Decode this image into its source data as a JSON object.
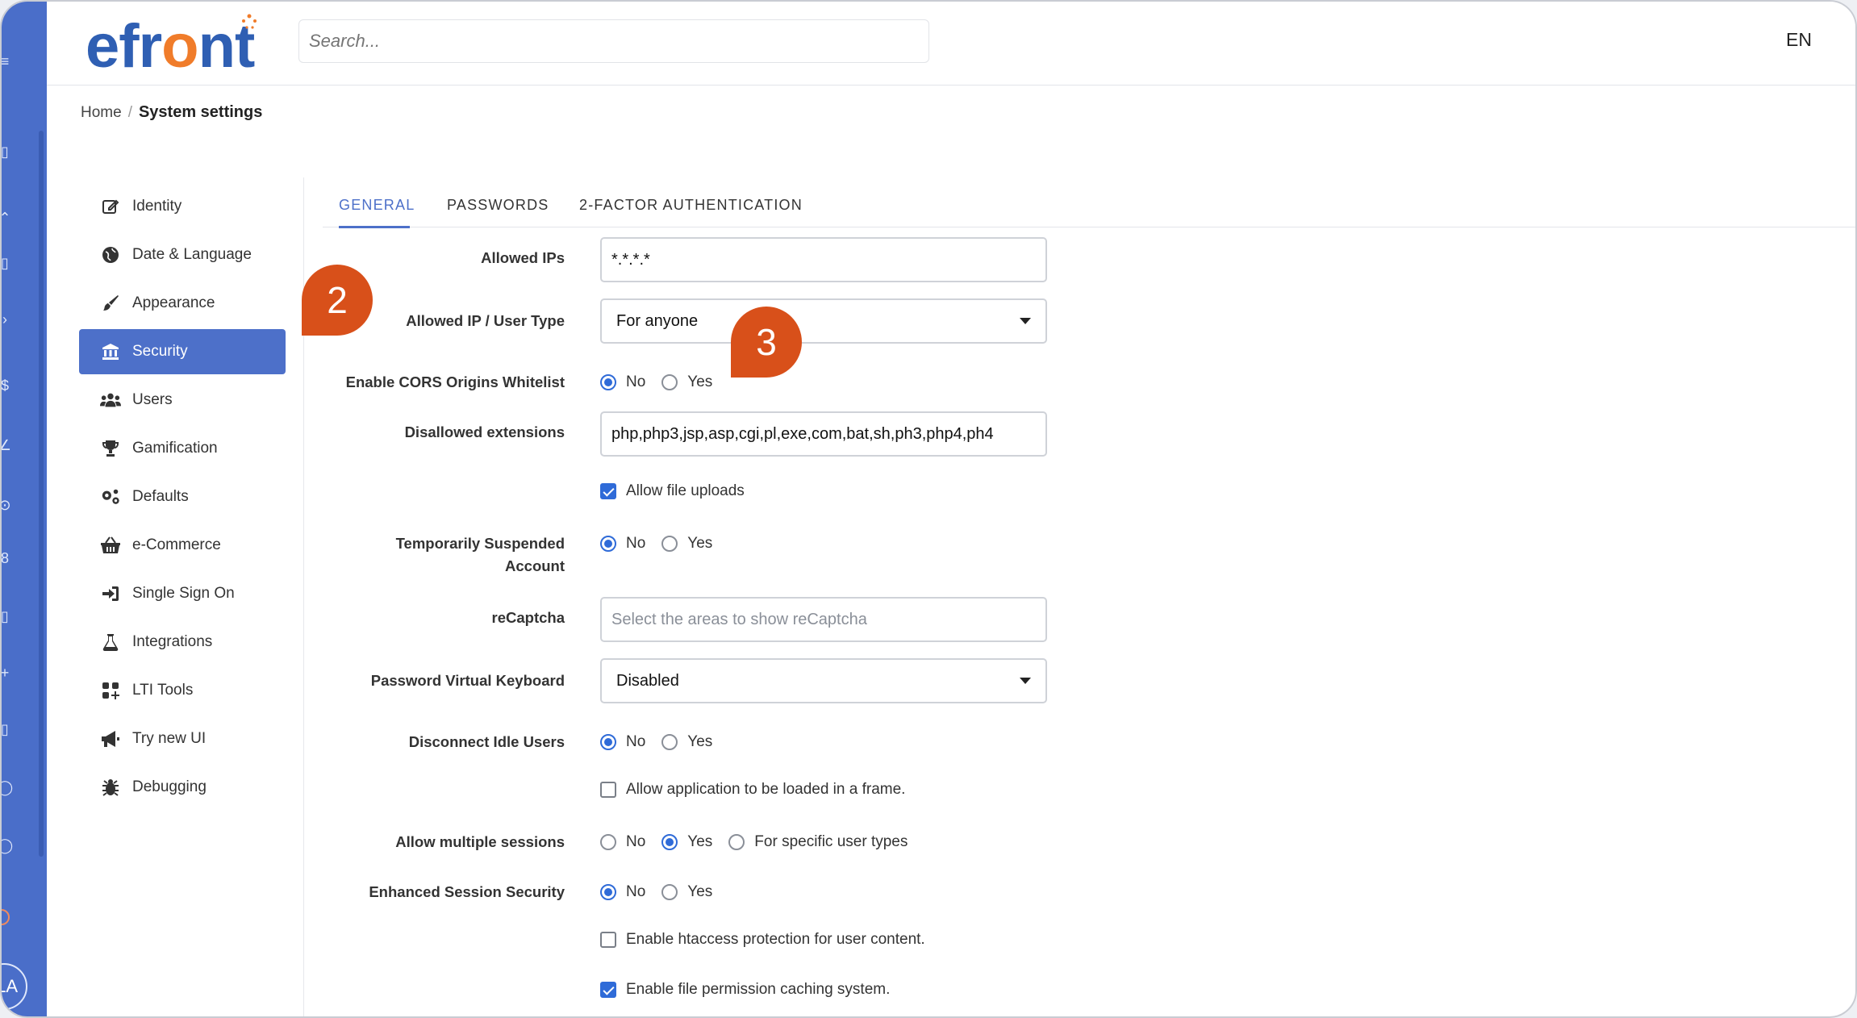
{
  "header": {
    "logo_text": "efront",
    "search_placeholder": "Search...",
    "language": "EN"
  },
  "breadcrumb": {
    "home": "Home",
    "separator": "/",
    "current": "System settings"
  },
  "sidebar": {
    "items": [
      {
        "label": "Identity",
        "icon": "edit-icon"
      },
      {
        "label": "Date & Language",
        "icon": "globe-icon"
      },
      {
        "label": "Appearance",
        "icon": "paintbrush-icon"
      },
      {
        "label": "Security",
        "icon": "bank-icon"
      },
      {
        "label": "Users",
        "icon": "users-icon"
      },
      {
        "label": "Gamification",
        "icon": "trophy-icon"
      },
      {
        "label": "Defaults",
        "icon": "gears-icon"
      },
      {
        "label": "e-Commerce",
        "icon": "basket-icon"
      },
      {
        "label": "Single Sign On",
        "icon": "sign-in-icon"
      },
      {
        "label": "Integrations",
        "icon": "flask-icon"
      },
      {
        "label": "LTI Tools",
        "icon": "tools-icon"
      },
      {
        "label": "Try new UI",
        "icon": "megaphone-icon"
      },
      {
        "label": "Debugging",
        "icon": "bug-icon"
      }
    ],
    "active": "Security"
  },
  "tabs": [
    {
      "label": "GENERAL",
      "active": true
    },
    {
      "label": "PASSWORDS",
      "active": false
    },
    {
      "label": "2-FACTOR AUTHENTICATION",
      "active": false
    }
  ],
  "form": {
    "allowed_ips": {
      "label": "Allowed IPs",
      "value": "*.*.*.*"
    },
    "allowed_ip_user_type": {
      "label": "Allowed IP / User Type",
      "value": "For anyone"
    },
    "cors": {
      "label": "Enable CORS Origins Whitelist",
      "options": [
        "No",
        "Yes"
      ],
      "selected": "No"
    },
    "disallowed_extensions": {
      "label": "Disallowed extensions",
      "value": "php,php3,jsp,asp,cgi,pl,exe,com,bat,sh,ph3,php4,ph4"
    },
    "allow_file_uploads": {
      "label": "Allow file uploads",
      "checked": true
    },
    "temporarily_suspended": {
      "label_line1": "Temporarily Suspended",
      "label_line2": "Account",
      "options": [
        "No",
        "Yes"
      ],
      "selected": "No"
    },
    "recaptcha": {
      "label": "reCaptcha",
      "placeholder": "Select the areas to show reCaptcha"
    },
    "password_keyboard": {
      "label": "Password Virtual Keyboard",
      "value": "Disabled"
    },
    "disconnect_idle": {
      "label": "Disconnect Idle Users",
      "options": [
        "No",
        "Yes"
      ],
      "selected": "No"
    },
    "allow_frame": {
      "label": "Allow application to be loaded in a frame.",
      "checked": false
    },
    "multiple_sessions": {
      "label": "Allow multiple sessions",
      "options": [
        "No",
        "Yes",
        "For specific user types"
      ],
      "selected": "Yes"
    },
    "enhanced_session": {
      "label": "Enhanced Session Security",
      "options": [
        "No",
        "Yes"
      ],
      "selected": "No"
    },
    "htaccess": {
      "label": "Enable htaccess protection for user content.",
      "checked": false
    },
    "permission_caching": {
      "label": "Enable file permission caching system.",
      "checked": true
    }
  },
  "callouts": [
    "2",
    "3"
  ],
  "user": {
    "initials": "LA"
  },
  "colors": {
    "accent": "#4d70c9",
    "callout": "#d8501a",
    "logo_blue": "#2f5fb3",
    "logo_orange": "#f07c2a"
  }
}
